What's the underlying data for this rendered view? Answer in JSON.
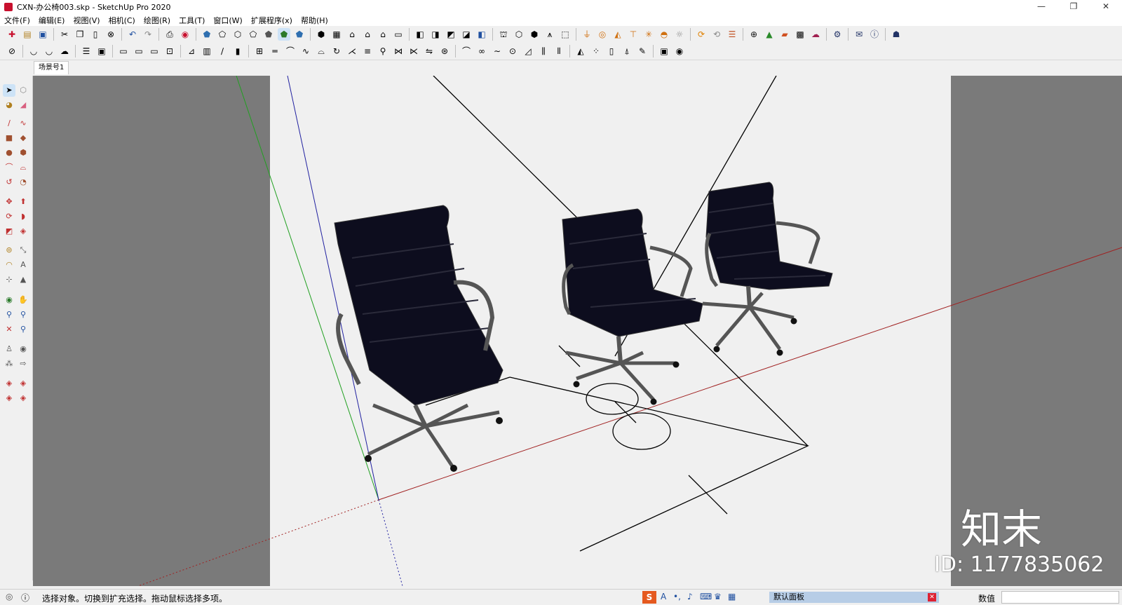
{
  "window": {
    "title": "CXN-办公椅003.skp - SketchUp Pro 2020",
    "min_glyph": "—",
    "restore_glyph": "❐",
    "close_glyph": "✕"
  },
  "menu": [
    "文件(F)",
    "编辑(E)",
    "视图(V)",
    "相机(C)",
    "绘图(R)",
    "工具(T)",
    "窗口(W)",
    "扩展程序(x)",
    "帮助(H)"
  ],
  "tabs": {
    "scene": "场景号1"
  },
  "status": {
    "geo_icon": "globe-icon",
    "info_icon": "info-icon",
    "message": "选择对象。切换到扩充选择。拖动鼠标选择多项。",
    "default_panel": "默认面板",
    "measurements_label": "数值",
    "measurements_value": ""
  },
  "watermark": {
    "brand": "知末",
    "id_text": "ID: 1177835062"
  },
  "colors": {
    "viewport_bg": "#7a7a7a",
    "canvas_bg": "#f0f0f0",
    "axis_red": "#a02020",
    "axis_green": "#20a020",
    "axis_blue": "#2020a0",
    "chair": "#0d0d1e"
  }
}
